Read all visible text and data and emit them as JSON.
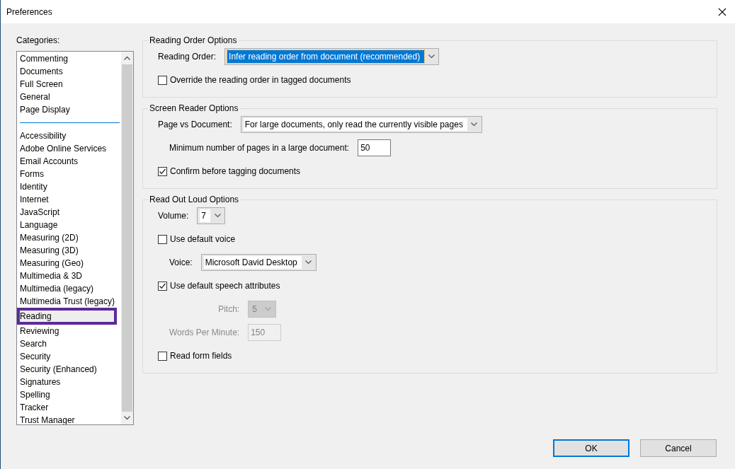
{
  "window": {
    "title": "Preferences"
  },
  "categories": {
    "label": "Categories:",
    "groups": [
      [
        {
          "label": "Commenting",
          "selected": false
        },
        {
          "label": "Documents",
          "selected": false
        },
        {
          "label": "Full Screen",
          "selected": false
        },
        {
          "label": "General",
          "selected": false
        },
        {
          "label": "Page Display",
          "selected": false
        }
      ],
      [
        {
          "label": "Accessibility",
          "selected": false
        },
        {
          "label": "Adobe Online Services",
          "selected": false
        },
        {
          "label": "Email Accounts",
          "selected": false
        },
        {
          "label": "Forms",
          "selected": false
        },
        {
          "label": "Identity",
          "selected": false
        },
        {
          "label": "Internet",
          "selected": false
        },
        {
          "label": "JavaScript",
          "selected": false
        },
        {
          "label": "Language",
          "selected": false
        },
        {
          "label": "Measuring (2D)",
          "selected": false
        },
        {
          "label": "Measuring (3D)",
          "selected": false
        },
        {
          "label": "Measuring (Geo)",
          "selected": false
        },
        {
          "label": "Multimedia & 3D",
          "selected": false
        },
        {
          "label": "Multimedia (legacy)",
          "selected": false
        },
        {
          "label": "Multimedia Trust (legacy)",
          "selected": false
        },
        {
          "label": "Reading",
          "selected": true
        },
        {
          "label": "Reviewing",
          "selected": false
        },
        {
          "label": "Search",
          "selected": false
        },
        {
          "label": "Security",
          "selected": false
        },
        {
          "label": "Security (Enhanced)",
          "selected": false
        },
        {
          "label": "Signatures",
          "selected": false
        },
        {
          "label": "Spelling",
          "selected": false
        },
        {
          "label": "Tracker",
          "selected": false
        },
        {
          "label": "Trust Manager",
          "selected": false
        }
      ]
    ]
  },
  "sections": [
    {
      "title": "Reading Order Options",
      "rows": [
        {
          "kind": "dropdown",
          "label": "Reading Order:",
          "value": "Infer reading order from document (recommended)",
          "focused": true,
          "disabled": false
        },
        {
          "kind": "checkbox",
          "label": "Override the reading order in tagged documents",
          "checked": false
        }
      ]
    },
    {
      "title": "Screen Reader Options",
      "rows": [
        {
          "kind": "dropdown",
          "label": "Page vs Document:",
          "value": "For large documents, only read the currently visible pages",
          "focused": false,
          "disabled": false,
          "children": [
            {
              "kind": "number",
              "label": "Minimum number of pages in a large document:",
              "value": "50",
              "disabled": false
            }
          ]
        },
        {
          "kind": "checkbox",
          "label": "Confirm before tagging documents",
          "checked": true
        }
      ]
    },
    {
      "title": "Read Out Loud Options",
      "rows": [
        {
          "kind": "dropdown",
          "label": "Volume:",
          "value": "7",
          "focused": false,
          "disabled": false
        },
        {
          "kind": "checkbox",
          "label": "Use default voice",
          "checked": false,
          "children": [
            {
              "kind": "dropdown",
              "label": "Voice:",
              "value": "Microsoft David Desktop",
              "focused": false,
              "disabled": false
            }
          ]
        },
        {
          "kind": "checkbox",
          "label": "Use default speech attributes",
          "checked": true,
          "children": [
            {
              "kind": "dropdown",
              "label": "Pitch:",
              "value": "5",
              "focused": false,
              "disabled": true
            },
            {
              "kind": "number",
              "label": "Words Per Minute:",
              "value": "150",
              "disabled": true
            }
          ]
        },
        {
          "kind": "checkbox",
          "label": "Read form fields",
          "checked": false
        }
      ]
    }
  ],
  "buttons": [
    {
      "label": "OK",
      "default": true
    },
    {
      "label": "Cancel",
      "default": false
    }
  ]
}
